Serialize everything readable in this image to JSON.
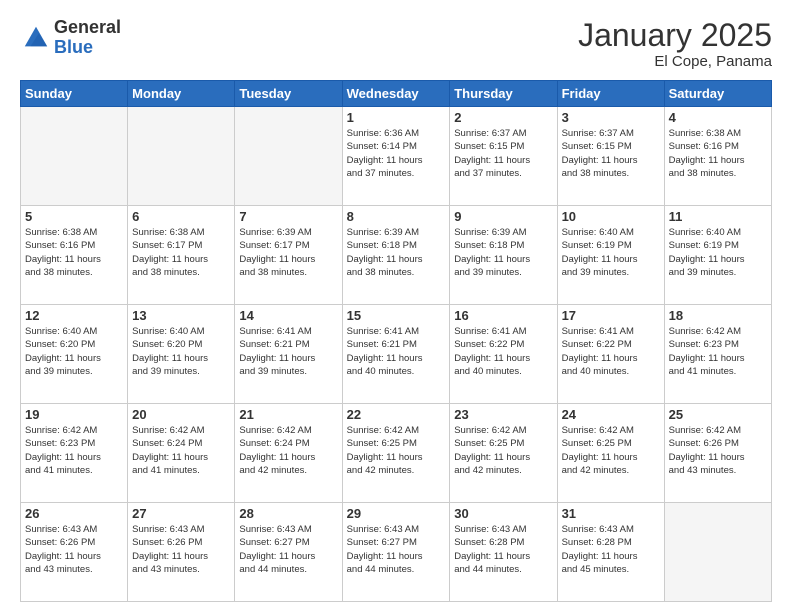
{
  "logo": {
    "general": "General",
    "blue": "Blue"
  },
  "header": {
    "month": "January 2025",
    "location": "El Cope, Panama"
  },
  "days_of_week": [
    "Sunday",
    "Monday",
    "Tuesday",
    "Wednesday",
    "Thursday",
    "Friday",
    "Saturday"
  ],
  "weeks": [
    [
      {
        "day": "",
        "info": ""
      },
      {
        "day": "",
        "info": ""
      },
      {
        "day": "",
        "info": ""
      },
      {
        "day": "1",
        "info": "Sunrise: 6:36 AM\nSunset: 6:14 PM\nDaylight: 11 hours\nand 37 minutes."
      },
      {
        "day": "2",
        "info": "Sunrise: 6:37 AM\nSunset: 6:15 PM\nDaylight: 11 hours\nand 37 minutes."
      },
      {
        "day": "3",
        "info": "Sunrise: 6:37 AM\nSunset: 6:15 PM\nDaylight: 11 hours\nand 38 minutes."
      },
      {
        "day": "4",
        "info": "Sunrise: 6:38 AM\nSunset: 6:16 PM\nDaylight: 11 hours\nand 38 minutes."
      }
    ],
    [
      {
        "day": "5",
        "info": "Sunrise: 6:38 AM\nSunset: 6:16 PM\nDaylight: 11 hours\nand 38 minutes."
      },
      {
        "day": "6",
        "info": "Sunrise: 6:38 AM\nSunset: 6:17 PM\nDaylight: 11 hours\nand 38 minutes."
      },
      {
        "day": "7",
        "info": "Sunrise: 6:39 AM\nSunset: 6:17 PM\nDaylight: 11 hours\nand 38 minutes."
      },
      {
        "day": "8",
        "info": "Sunrise: 6:39 AM\nSunset: 6:18 PM\nDaylight: 11 hours\nand 38 minutes."
      },
      {
        "day": "9",
        "info": "Sunrise: 6:39 AM\nSunset: 6:18 PM\nDaylight: 11 hours\nand 39 minutes."
      },
      {
        "day": "10",
        "info": "Sunrise: 6:40 AM\nSunset: 6:19 PM\nDaylight: 11 hours\nand 39 minutes."
      },
      {
        "day": "11",
        "info": "Sunrise: 6:40 AM\nSunset: 6:19 PM\nDaylight: 11 hours\nand 39 minutes."
      }
    ],
    [
      {
        "day": "12",
        "info": "Sunrise: 6:40 AM\nSunset: 6:20 PM\nDaylight: 11 hours\nand 39 minutes."
      },
      {
        "day": "13",
        "info": "Sunrise: 6:40 AM\nSunset: 6:20 PM\nDaylight: 11 hours\nand 39 minutes."
      },
      {
        "day": "14",
        "info": "Sunrise: 6:41 AM\nSunset: 6:21 PM\nDaylight: 11 hours\nand 39 minutes."
      },
      {
        "day": "15",
        "info": "Sunrise: 6:41 AM\nSunset: 6:21 PM\nDaylight: 11 hours\nand 40 minutes."
      },
      {
        "day": "16",
        "info": "Sunrise: 6:41 AM\nSunset: 6:22 PM\nDaylight: 11 hours\nand 40 minutes."
      },
      {
        "day": "17",
        "info": "Sunrise: 6:41 AM\nSunset: 6:22 PM\nDaylight: 11 hours\nand 40 minutes."
      },
      {
        "day": "18",
        "info": "Sunrise: 6:42 AM\nSunset: 6:23 PM\nDaylight: 11 hours\nand 41 minutes."
      }
    ],
    [
      {
        "day": "19",
        "info": "Sunrise: 6:42 AM\nSunset: 6:23 PM\nDaylight: 11 hours\nand 41 minutes."
      },
      {
        "day": "20",
        "info": "Sunrise: 6:42 AM\nSunset: 6:24 PM\nDaylight: 11 hours\nand 41 minutes."
      },
      {
        "day": "21",
        "info": "Sunrise: 6:42 AM\nSunset: 6:24 PM\nDaylight: 11 hours\nand 42 minutes."
      },
      {
        "day": "22",
        "info": "Sunrise: 6:42 AM\nSunset: 6:25 PM\nDaylight: 11 hours\nand 42 minutes."
      },
      {
        "day": "23",
        "info": "Sunrise: 6:42 AM\nSunset: 6:25 PM\nDaylight: 11 hours\nand 42 minutes."
      },
      {
        "day": "24",
        "info": "Sunrise: 6:42 AM\nSunset: 6:25 PM\nDaylight: 11 hours\nand 42 minutes."
      },
      {
        "day": "25",
        "info": "Sunrise: 6:42 AM\nSunset: 6:26 PM\nDaylight: 11 hours\nand 43 minutes."
      }
    ],
    [
      {
        "day": "26",
        "info": "Sunrise: 6:43 AM\nSunset: 6:26 PM\nDaylight: 11 hours\nand 43 minutes."
      },
      {
        "day": "27",
        "info": "Sunrise: 6:43 AM\nSunset: 6:26 PM\nDaylight: 11 hours\nand 43 minutes."
      },
      {
        "day": "28",
        "info": "Sunrise: 6:43 AM\nSunset: 6:27 PM\nDaylight: 11 hours\nand 44 minutes."
      },
      {
        "day": "29",
        "info": "Sunrise: 6:43 AM\nSunset: 6:27 PM\nDaylight: 11 hours\nand 44 minutes."
      },
      {
        "day": "30",
        "info": "Sunrise: 6:43 AM\nSunset: 6:28 PM\nDaylight: 11 hours\nand 44 minutes."
      },
      {
        "day": "31",
        "info": "Sunrise: 6:43 AM\nSunset: 6:28 PM\nDaylight: 11 hours\nand 45 minutes."
      },
      {
        "day": "",
        "info": ""
      }
    ]
  ]
}
